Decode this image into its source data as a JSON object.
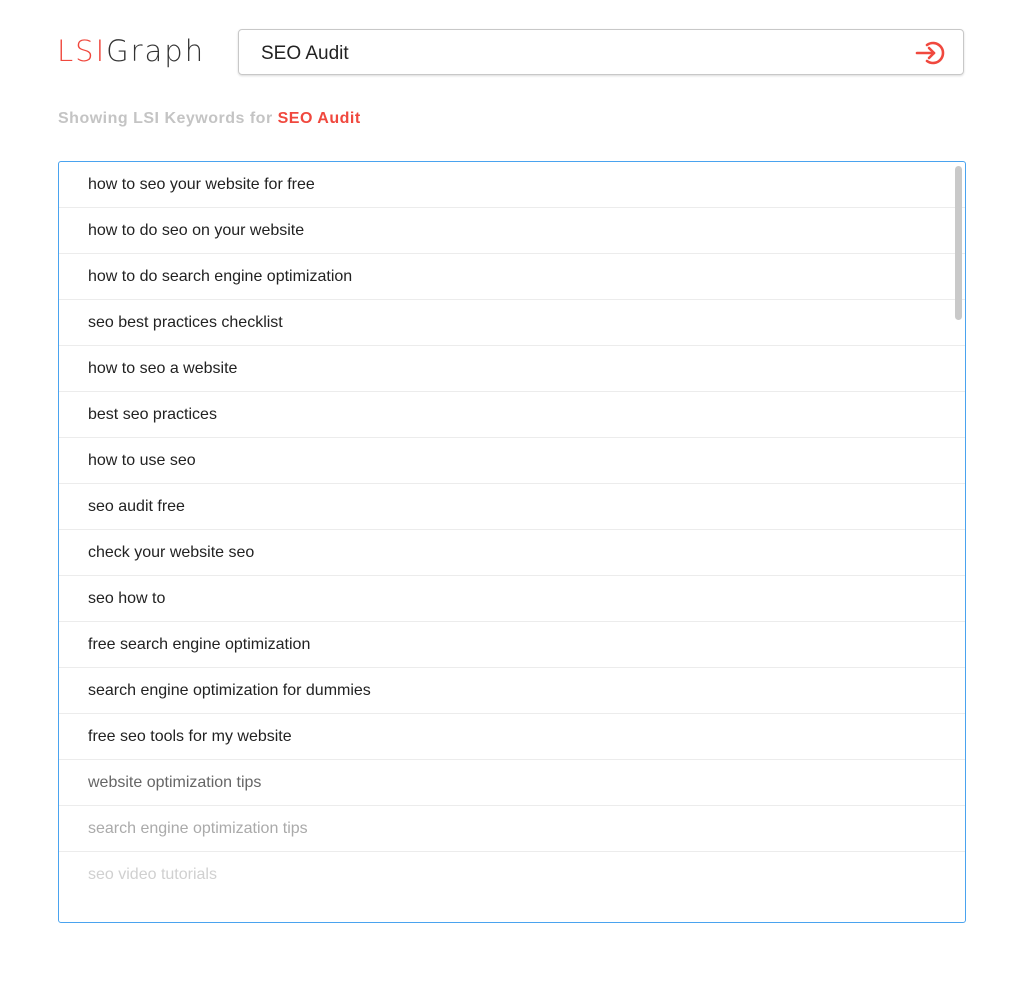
{
  "logo": {
    "part1": "LSI",
    "part2": "Graph"
  },
  "search": {
    "value": "SEO Audit",
    "icon": "arrow-circle-enter-icon"
  },
  "heading": {
    "prefix": "Showing LSI Keywords for ",
    "query": "SEO Audit"
  },
  "colors": {
    "accent": "#f0483e",
    "list_border": "#4aa3ef"
  },
  "keywords": [
    "how to seo your website for free",
    "how to do seo on your website",
    "how to do search engine optimization",
    "seo best practices checklist",
    "how to seo a website",
    "best seo practices",
    "how to use seo",
    "seo audit free",
    "check your website seo",
    "seo how to",
    "free search engine optimization",
    "search engine optimization for dummies",
    "free seo tools for my website",
    "website optimization tips",
    "search engine optimization tips",
    "seo video tutorials"
  ]
}
